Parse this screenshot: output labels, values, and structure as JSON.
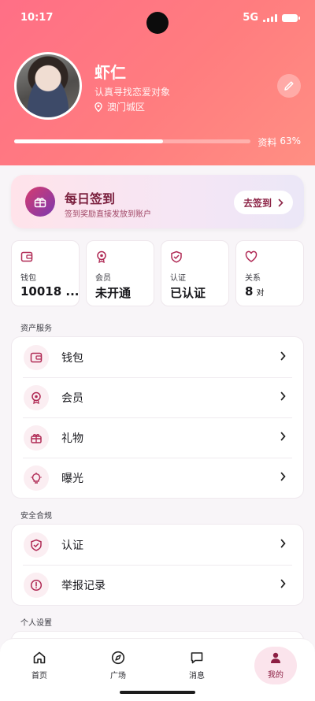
{
  "status_bar": {
    "time": "10:17",
    "network": "5G"
  },
  "profile": {
    "name": "虾仁",
    "bio": "认真寻找恋爱对象",
    "location": "澳门城区",
    "completion_label": "资料",
    "completion_percent": "63%",
    "completion_value": 63
  },
  "checkin": {
    "title": "每日签到",
    "subtitle": "签到奖励直接发放到账户",
    "button": "去签到"
  },
  "stats": [
    {
      "label": "钱包",
      "value": "10018 ...",
      "unit": "",
      "icon": "wallet-icon"
    },
    {
      "label": "会员",
      "value": "未开通",
      "unit": "",
      "icon": "member-badge-icon"
    },
    {
      "label": "认证",
      "value": "已认证",
      "unit": "",
      "icon": "shield-check-icon"
    },
    {
      "label": "关系",
      "value": "8",
      "unit": "对",
      "icon": "heart-icon"
    }
  ],
  "sections": {
    "assets": {
      "title": "资产服务",
      "items": [
        {
          "label": "钱包",
          "icon": "wallet-icon"
        },
        {
          "label": "会员",
          "icon": "member-badge-icon"
        },
        {
          "label": "礼物",
          "icon": "gift-icon"
        },
        {
          "label": "曝光",
          "icon": "lightbulb-icon"
        }
      ]
    },
    "safety": {
      "title": "安全合规",
      "items": [
        {
          "label": "认证",
          "icon": "shield-check-icon"
        },
        {
          "label": "举报记录",
          "icon": "alert-icon"
        }
      ]
    },
    "personal": {
      "title": "个人设置"
    }
  },
  "bottom_nav": [
    {
      "label": "首页",
      "icon": "home-icon"
    },
    {
      "label": "广场",
      "icon": "compass-icon"
    },
    {
      "label": "消息",
      "icon": "message-icon"
    },
    {
      "label": "我的",
      "icon": "person-icon",
      "active": true
    }
  ],
  "colors": {
    "accent": "#8c1f43",
    "header_start": "#ff6f86",
    "header_end": "#ff8f83",
    "icon_bg": "#fbeef2"
  }
}
